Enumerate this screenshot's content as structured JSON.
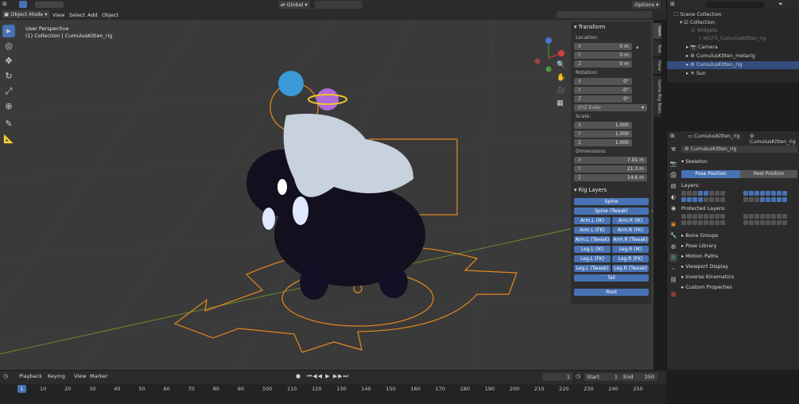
{
  "top_header": {
    "mode": "Object Mode",
    "menus": [
      "View",
      "Select",
      "Add",
      "Object"
    ],
    "orientation": "Global",
    "options": "Options"
  },
  "viewport": {
    "title": "User Perspective",
    "subtitle": "(1) Collection | CumulusKitten_rig"
  },
  "npanel": {
    "transform_title": "Transform",
    "location_label": "Location:",
    "location": [
      {
        "axis": "X",
        "value": "0 m"
      },
      {
        "axis": "Y",
        "value": "0 m"
      },
      {
        "axis": "Z",
        "value": "0 m"
      }
    ],
    "rotation_label": "Rotation:",
    "rotation": [
      {
        "axis": "X",
        "value": "0°"
      },
      {
        "axis": "Y",
        "value": "-0°"
      },
      {
        "axis": "Z",
        "value": "0°"
      }
    ],
    "rotation_mode": "XYZ Euler",
    "scale_label": "Scale:",
    "scale": [
      {
        "axis": "X",
        "value": "1.000"
      },
      {
        "axis": "Y",
        "value": "1.000"
      },
      {
        "axis": "Z",
        "value": "1.000"
      }
    ],
    "dimensions_label": "Dimensions:",
    "dimensions": [
      {
        "axis": "X",
        "value": "7.01 m"
      },
      {
        "axis": "Y",
        "value": "21.3 m"
      },
      {
        "axis": "Z",
        "value": "14.6 m"
      }
    ],
    "rig_layers_title": "Rig Layers",
    "rig_layers": {
      "spine": "Spine",
      "spine_tweak": "Spine (Tweak)",
      "arm_l_ik": "Arm.L (IK)",
      "arm_r_ik": "Arm.R (IK)",
      "arm_l_fk": "Arm.L (FK)",
      "arm_r_fk": "Arm.R (FK)",
      "arm_l_tweak": "Arm.L (Tweak)",
      "arm_r_tweak": "Arm.R (Tweak)",
      "leg_l_ik": "Leg.L (IK)",
      "leg_r_ik": "Leg.R (IK)",
      "leg_l_fk": "Leg.L (FK)",
      "leg_r_fk": "Leg.R (FK)",
      "leg_l_tweak": "Leg.L (Tweak)",
      "leg_r_tweak": "Leg.R (Tweak)",
      "tail": "Tail",
      "root": "Root"
    }
  },
  "side_tabs": [
    "Item",
    "Tool",
    "View",
    "Game Rig Tools"
  ],
  "outliner": {
    "rows": [
      "Scene Collection",
      "Collection",
      "Widgets",
      "WGTS_CumulusKitten_rig",
      "Camera",
      "CumulusKitten_metarig",
      "CumulusKitten_rig",
      "Sun"
    ]
  },
  "properties": {
    "object_name": "CumulusKitten_rig",
    "data_name": "CumulusKitten_rig",
    "armature_name": "CumulusKitten_rig",
    "skeleton": "Skeleton",
    "pose_position": "Pose Position",
    "rest_position": "Rest Position",
    "layers_label": "Layers:",
    "protected_layers_label": "Protected Layers:",
    "sections": [
      "Bone Groups",
      "Pose Library",
      "Motion Paths",
      "Viewport Display",
      "Inverse Kinematics",
      "Custom Properties"
    ]
  },
  "timeline": {
    "menus": [
      "Playback",
      "Keying",
      "View",
      "Marker"
    ],
    "current_frame": "1",
    "start_label": "Start",
    "start": "1",
    "end_label": "End",
    "end": "250",
    "ruler": [
      "1",
      "10",
      "20",
      "30",
      "40",
      "50",
      "60",
      "70",
      "80",
      "90",
      "100",
      "110",
      "120",
      "130",
      "140",
      "150",
      "160",
      "170",
      "180",
      "190",
      "200",
      "210",
      "220",
      "230",
      "240",
      "250"
    ]
  },
  "colors": {
    "accent": "#4772b3",
    "rig_orange": "#e8891c",
    "bg": "#3a3a3a"
  }
}
